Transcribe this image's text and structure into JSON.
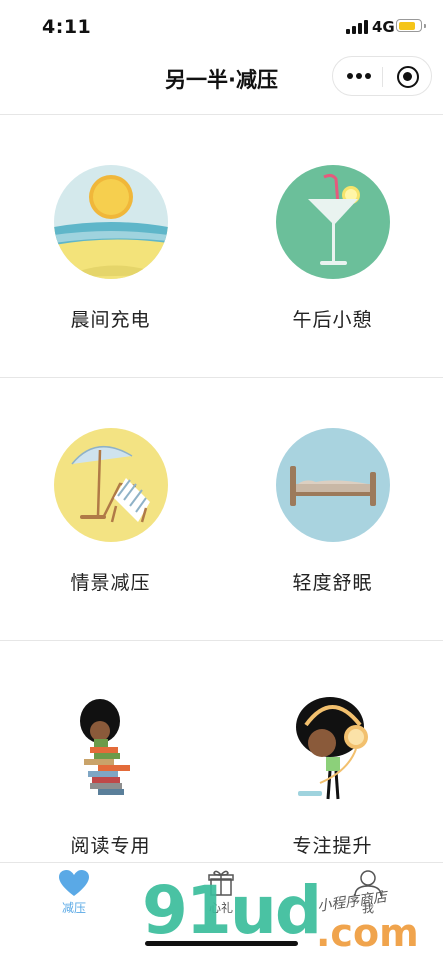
{
  "status": {
    "time": "4:11",
    "network": "4G",
    "battery_level": 0.8
  },
  "nav": {
    "title": "另一半·减压"
  },
  "grid": {
    "items": [
      {
        "label": "晨间充电",
        "icon": "sunrise-beach-icon"
      },
      {
        "label": "午后小憩",
        "icon": "cocktail-glass-icon"
      },
      {
        "label": "情景减压",
        "icon": "beach-umbrella-chair-icon"
      },
      {
        "label": "轻度舒眠",
        "icon": "bed-icon"
      },
      {
        "label": "阅读专用",
        "icon": "reading-books-icon"
      },
      {
        "label": "专注提升",
        "icon": "headphones-listener-icon"
      }
    ]
  },
  "tabbar": {
    "tabs": [
      {
        "label": "减压",
        "icon": "heart-icon",
        "active": true
      },
      {
        "label": "心礼",
        "icon": "gift-icon",
        "active": false
      },
      {
        "label": "我",
        "icon": "person-icon",
        "active": false
      }
    ],
    "active_color": "#5aa9e6",
    "inactive_color": "#666666"
  },
  "watermark": {
    "main": "91ud",
    "suffix": ".com",
    "shop": "小程序商店"
  }
}
